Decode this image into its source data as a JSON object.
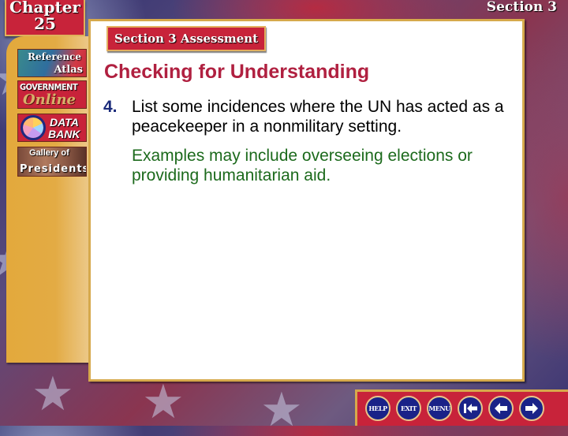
{
  "header": {
    "chapter_label": "Chapter",
    "chapter_number": "25",
    "section_label": "Section 3"
  },
  "sidebar": {
    "items": [
      {
        "id": "reference-atlas",
        "line1": "Reference",
        "line2": "Atlas"
      },
      {
        "id": "government-online",
        "line1": "GOVERNMENT",
        "line2": "Online"
      },
      {
        "id": "data-bank",
        "line1": "DATA",
        "line2": "BANK"
      },
      {
        "id": "gallery-of-presidents",
        "line1": "Gallery of",
        "line2": "Presidents"
      }
    ]
  },
  "main": {
    "section_tag": "Section 3 Assessment",
    "heading": "Checking for Understanding",
    "question_number": "4.",
    "question_text": "List some incidences where the UN has acted as a peacekeeper in a nonmilitary setting.",
    "answer_text": "Examples may include overseeing elections or providing humanitarian aid."
  },
  "navbar": {
    "help_label": "HELP",
    "exit_label": "EXIT",
    "menu_label": "MENU",
    "buttons": [
      "help",
      "exit",
      "menu",
      "first",
      "previous",
      "next"
    ]
  },
  "colors": {
    "accent_red": "#c8233a",
    "heading_red": "#b02040",
    "gold": "#e3a93c",
    "answer_green": "#1c6a1c",
    "question_number_blue": "#1a2a7a",
    "nav_blue": "#1a2288"
  }
}
